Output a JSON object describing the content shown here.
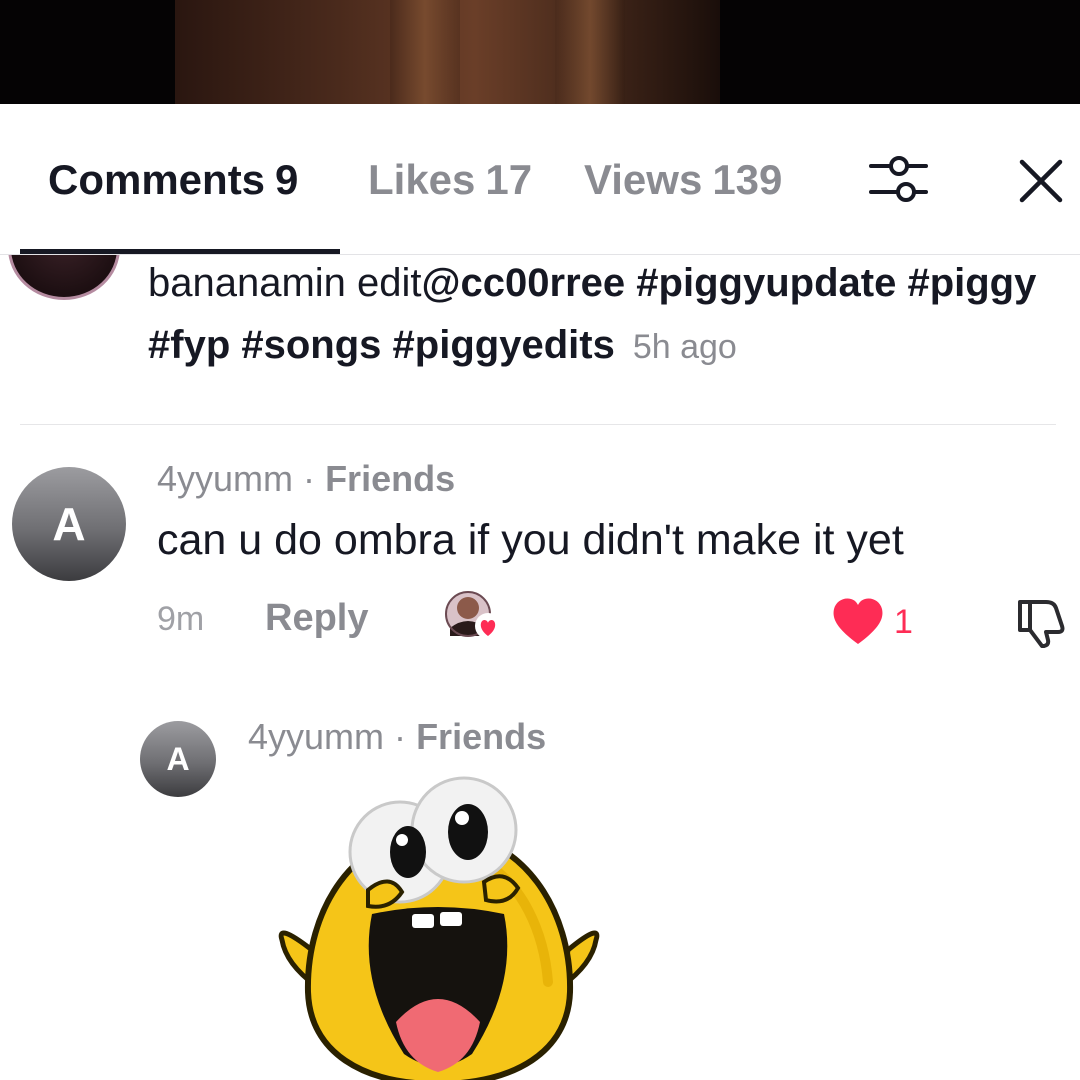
{
  "header": {
    "tabs": [
      {
        "label": "Comments",
        "count": "9"
      },
      {
        "label": "Likes",
        "count": "17"
      },
      {
        "label": "Views",
        "count": "139"
      }
    ]
  },
  "caption": {
    "text_plain": "bananamin edit",
    "handle": "@cc00rree",
    "tags": [
      "#piggyupdate",
      "#piggy",
      "#fyp",
      "#songs",
      "#piggyedits"
    ],
    "time": "5h ago"
  },
  "comment": {
    "avatar_letter": "A",
    "username": "4yyumm",
    "separator": "·",
    "relation": "Friends",
    "text": "can u do ombra if you didn't make it yet",
    "time": "9m",
    "reply_label": "Reply",
    "like_count": "1",
    "reply": {
      "avatar_letter": "A",
      "username": "4yyumm",
      "separator": "·",
      "relation": "Friends",
      "sticker": "yellow-blob-laughing-sticker"
    }
  },
  "colors": {
    "like_red": "#fe2c55",
    "text_primary": "#161823",
    "text_secondary": "#8a8b91",
    "sticker_yellow": "#f5c518"
  },
  "icons": [
    "filter-icon",
    "close-icon",
    "heart-icon",
    "dislike-icon",
    "creator-liked-badge"
  ]
}
